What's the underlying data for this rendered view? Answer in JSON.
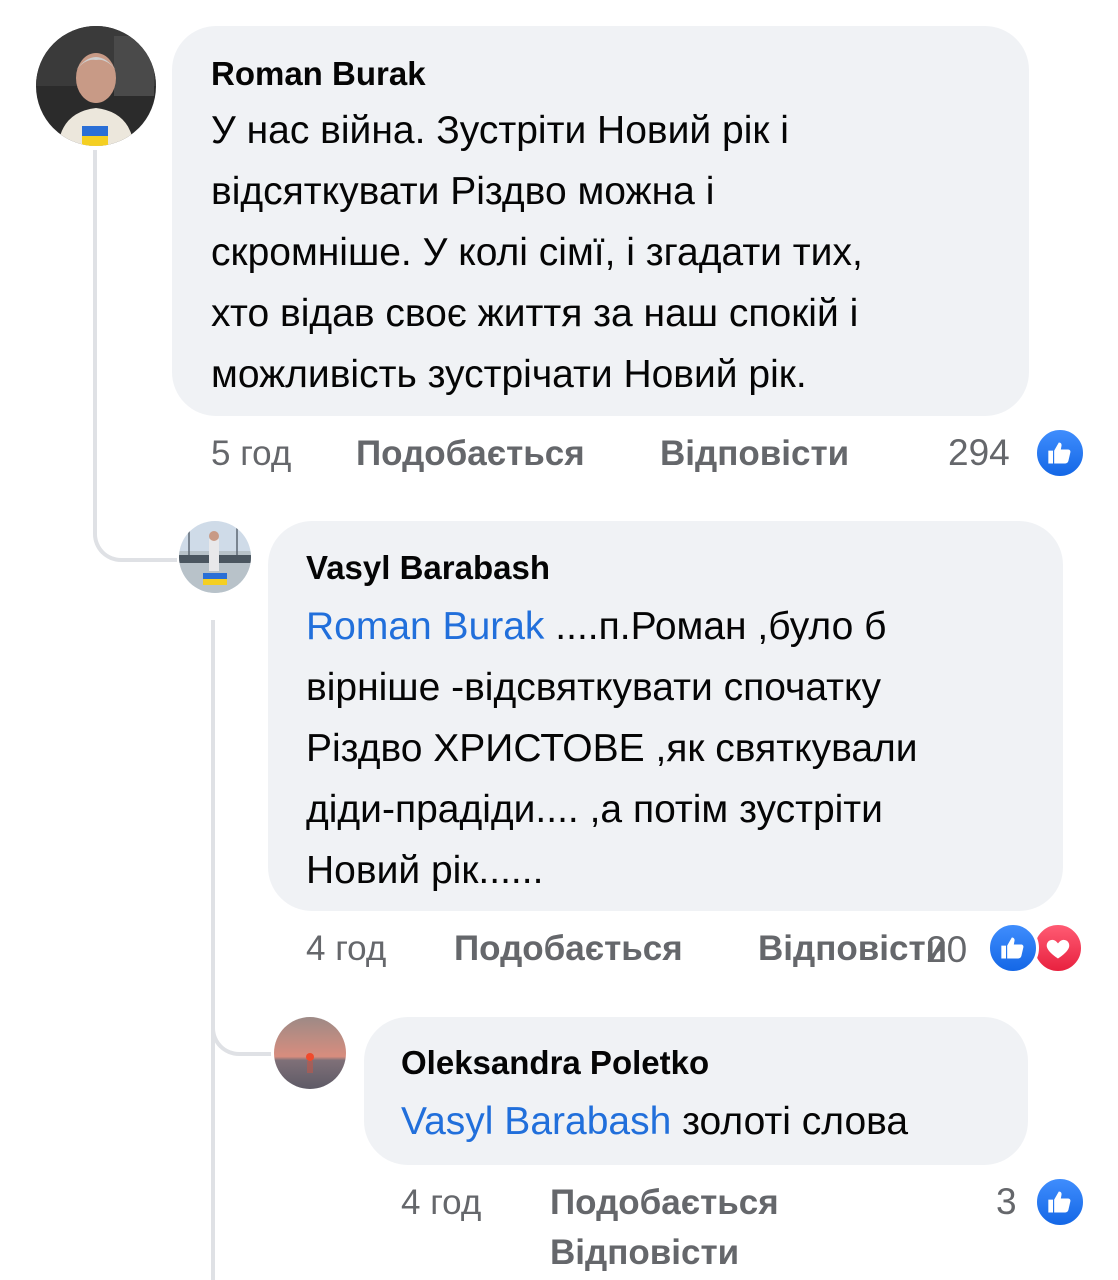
{
  "comments": [
    {
      "author": "Roman Burak",
      "text_lines": [
        "У нас війна. Зустріти Новий рік і",
        "відсяткувати Різдво можна і",
        "скромніше. У колі сімї, і згадати тих,",
        "хто відав своє життя за наш спокій і",
        "можливість зустрічати Новий рік."
      ],
      "time": "5 год",
      "like_label": "Подобається",
      "reply_label": "Відповісти",
      "reaction_count": "294",
      "reactions": [
        "like-icon"
      ]
    },
    {
      "author": "Vasyl Barabash",
      "mention": "Roman Burak",
      "text_lines": [
        " ....п.Роман ,було б",
        "вірніше -відсвяткувати спочатку",
        "Різдво ХРИСТОВЕ  ,як святкували",
        "діди-прадіди.... ,а потім зустріти",
        "Новий рік......"
      ],
      "time": "4 год",
      "like_label": "Подобається",
      "reply_label": "Відповісти",
      "reaction_count": "20",
      "reactions": [
        "like-icon",
        "love-icon"
      ]
    },
    {
      "author": "Oleksandra Poletko",
      "mention": "Vasyl Barabash",
      "text_lines": [
        " золоті слова"
      ],
      "time": "4 год",
      "like_label": "Подобається",
      "reply_label": "Відповісти",
      "reaction_count": "3",
      "reactions": [
        "like-icon"
      ]
    }
  ],
  "colors": {
    "mention": "#216fdb",
    "bubble": "#f0f2f5",
    "meta": "#65676b",
    "like": "#1877f2",
    "love": "#f02849"
  }
}
